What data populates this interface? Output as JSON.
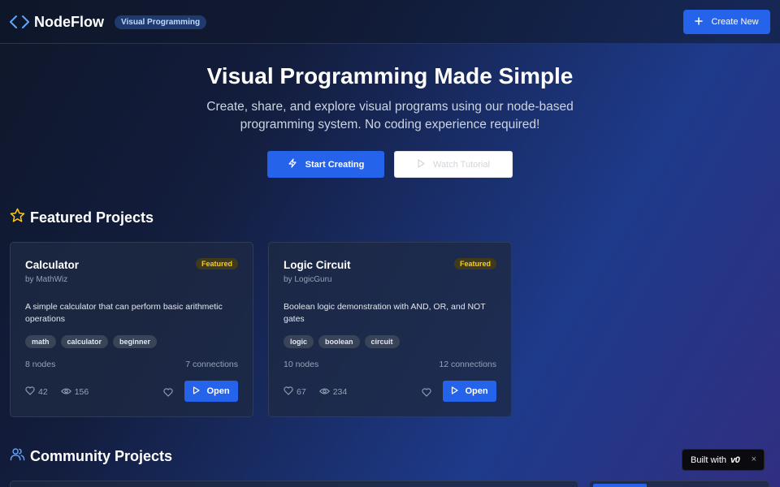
{
  "header": {
    "app_name": "NodeFlow",
    "badge": "Visual Programming",
    "create_label": "Create New",
    "brand_icon": "code-icon",
    "create_icon": "plus-icon"
  },
  "hero": {
    "title": "Visual Programming Made Simple",
    "subtitle": "Create, share, and explore visual programs using our node-based programming system. No coding experience required!",
    "start_label": "Start Creating",
    "watch_label": "Watch Tutorial",
    "start_icon": "zap-icon",
    "watch_icon": "play-icon"
  },
  "featured": {
    "title": "Featured Projects",
    "icon": "star-icon",
    "projects": [
      {
        "title": "Calculator",
        "author": "by MathWiz",
        "badge": "Featured",
        "description": "A simple calculator that can perform basic arithmetic operations",
        "tags": [
          "math",
          "calculator",
          "beginner"
        ],
        "nodes": "8 nodes",
        "connections": "7 connections",
        "likes": "42",
        "views": "156",
        "open_label": "Open"
      },
      {
        "title": "Logic Circuit",
        "author": "by LogicGuru",
        "badge": "Featured",
        "description": "Boolean logic demonstration with AND, OR, and NOT gates",
        "tags": [
          "logic",
          "boolean",
          "circuit"
        ],
        "nodes": "10 nodes",
        "connections": "12 connections",
        "likes": "67",
        "views": "234",
        "open_label": "Open"
      }
    ]
  },
  "community": {
    "title": "Community Projects",
    "icon": "users-icon"
  },
  "built_with": {
    "label": "Built with",
    "logo": "v0",
    "close": "×"
  },
  "colors": {
    "accent": "#2563eb",
    "featured_badge": "#facc15",
    "brand_icon": "#60a5fa"
  }
}
